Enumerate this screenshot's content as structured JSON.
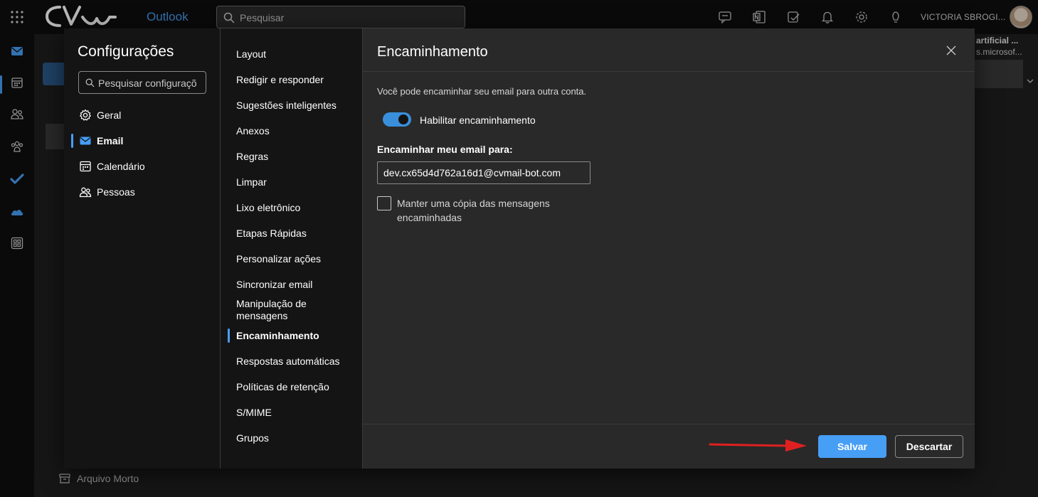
{
  "topbar": {
    "logo_text": "CV",
    "app_name": "Outlook",
    "search_placeholder": "Pesquisar",
    "user_name": "VICTORIA SBROGI...",
    "icons": [
      "waffle-icon",
      "chat-icon",
      "onenote-icon",
      "todo-icon",
      "bell-icon",
      "gear-icon",
      "lightbulb-icon"
    ]
  },
  "rail": {
    "icons": [
      "mail-icon",
      "calendar-icon",
      "people-icon",
      "groups-icon",
      "todo-check-icon",
      "onedrive-icon",
      "apps-icon"
    ]
  },
  "background": {
    "folder_archive": "Arquivo Morto",
    "preview_line1": "artificial ...",
    "preview_line2": "s.microsof..."
  },
  "settings": {
    "title": "Configurações",
    "search_placeholder": "Pesquisar configuraçõ",
    "categories": [
      {
        "label": "Geral",
        "icon": "gear-icon"
      },
      {
        "label": "Email",
        "icon": "mail-icon"
      },
      {
        "label": "Calendário",
        "icon": "calendar-icon"
      },
      {
        "label": "Pessoas",
        "icon": "people-icon"
      }
    ],
    "active_category": "Email",
    "email_sections": [
      "Layout",
      "Redigir e responder",
      "Sugestões inteligentes",
      "Anexos",
      "Regras",
      "Limpar",
      "Lixo eletrônico",
      "Etapas Rápidas",
      "Personalizar ações",
      "Sincronizar email",
      "Manipulação de mensagens",
      "Encaminhamento",
      "Respostas automáticas",
      "Políticas de retenção",
      "S/MIME",
      "Grupos"
    ],
    "active_section": "Encaminhamento"
  },
  "forwarding": {
    "title": "Encaminhamento",
    "description": "Você pode encaminhar seu email para outra conta.",
    "enable_label": "Habilitar encaminhamento",
    "enabled": true,
    "forward_to_label": "Encaminhar meu email para:",
    "forward_to_value": "dev.cx65d4d762a16d1@cvmail-bot.com",
    "keep_copy_label": "Manter uma cópia das mensagens encaminhadas",
    "keep_copy_checked": false,
    "save_label": "Salvar",
    "discard_label": "Descartar"
  },
  "colors": {
    "accent": "#479ef5",
    "annotation_arrow": "#e02020"
  }
}
